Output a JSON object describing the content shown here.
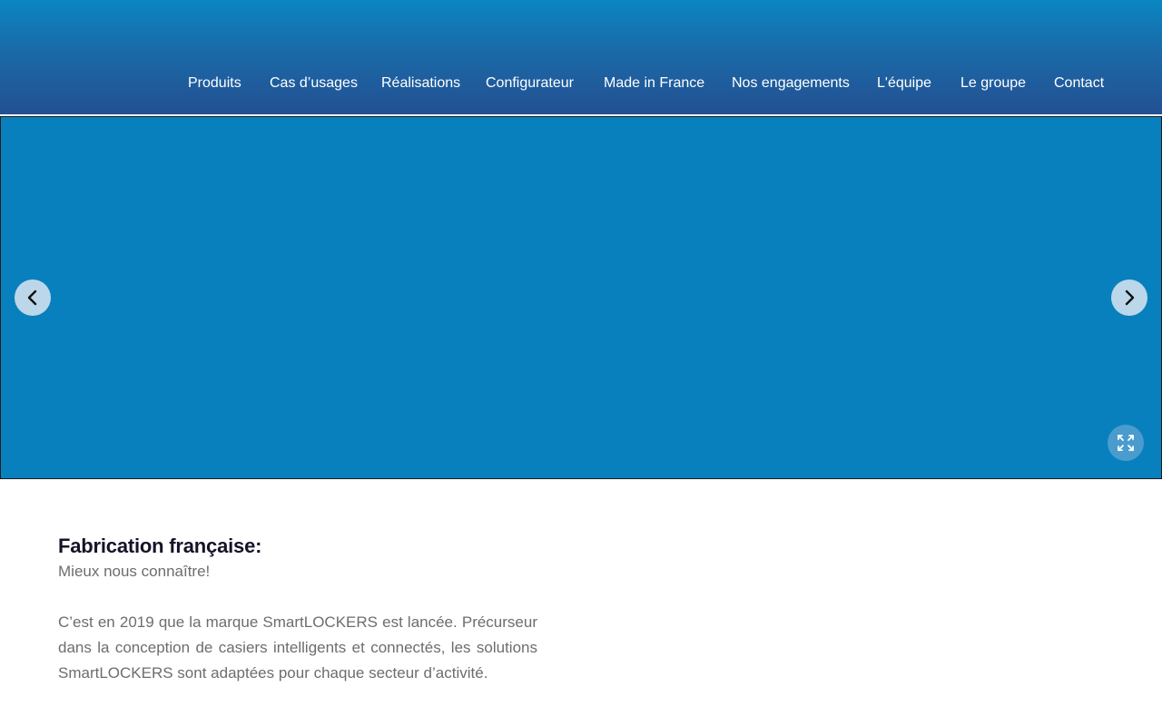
{
  "nav": {
    "items": [
      {
        "label": "Produits"
      },
      {
        "label": "Cas d’usages"
      },
      {
        "label": "Réalisations"
      },
      {
        "label": "Configurateur"
      },
      {
        "label": "Made in France"
      },
      {
        "label": "Nos engagements"
      },
      {
        "label": "L'équipe"
      },
      {
        "label": "Le groupe"
      },
      {
        "label": "Contact"
      }
    ]
  },
  "slider": {
    "background": "#0880be",
    "prev_icon": "chevron-left-icon",
    "next_icon": "chevron-right-icon",
    "fullscreen_icon": "expand-icon"
  },
  "content": {
    "heading": "Fabrication française:",
    "subtitle": "Mieux nous connaître!",
    "paragraph": "C’est en 2019 que la marque SmartLOCKERS est lancée. Précurseur dans la conception de casiers intelligents et connectés, les solutions SmartLOCKERS sont adaptées pour chaque secteur d’activité."
  },
  "colors": {
    "header_top": "#0a86c2",
    "header_bottom": "#235092",
    "heading_text": "#141428",
    "body_text": "#6d6d6d"
  }
}
